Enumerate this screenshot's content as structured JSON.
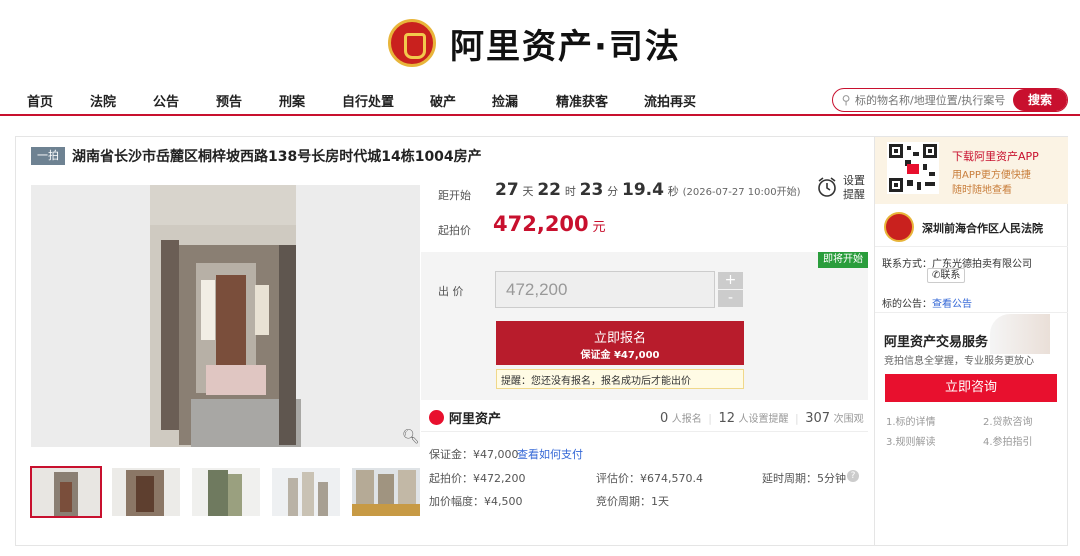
{
  "header": {
    "brand": "阿里资产·司法",
    "nav": [
      "首页",
      "法院",
      "公告",
      "预告",
      "刑案",
      "自行处置",
      "破产",
      "捡漏",
      "精准获客",
      "流拍再买"
    ],
    "search_placeholder": "标的物名称/地理位置/执行案号",
    "search_button": "搜索"
  },
  "item": {
    "badge": "一拍",
    "title": "湖南省长沙市岳麓区桐梓坡西路138号长房时代城14栋1004房产"
  },
  "countdown": {
    "label": "距开始",
    "days": "27",
    "days_unit": "天",
    "hours": "22",
    "hours_unit": "时",
    "minutes": "23",
    "minutes_unit": "分",
    "seconds": "19.4",
    "seconds_unit": "秒",
    "start_time": "(2026-07-27 10:00开始)",
    "remind_line1": "设置",
    "remind_line2": "提醒"
  },
  "price": {
    "label": "起拍价",
    "value": "472,200",
    "unit": "元"
  },
  "bid": {
    "label": "出 价",
    "input_value": "472,200",
    "plus": "+",
    "minus": "-",
    "soon_badge": "即将开始",
    "apply_line1": "立即报名",
    "apply_line2": "保证金 ¥47,000",
    "tip": "提醒：您还没有报名，报名成功后才能出价"
  },
  "stats": {
    "brand": "阿里资产",
    "signups": "0",
    "signups_label": "人报名",
    "reminders": "12",
    "reminders_label": "人设置提醒",
    "watchers": "307",
    "watchers_label": "次围观"
  },
  "details": {
    "deposit": "保证金：¥47,000",
    "deposit_link": "查看如何支付",
    "start_price": "起拍价：¥472,200",
    "appraisal": "评估价：¥674,570.4",
    "delay": "延时周期：5分钟",
    "increment": "加价幅度：¥4,500",
    "period": "竞价周期：1天"
  },
  "sidebar": {
    "app_title": "下载阿里资产APP",
    "app_line1": "用APP更方便快捷",
    "app_line2": "随时随地查看",
    "court": "深圳前海合作区人民法院",
    "contact_label": "联系方式：",
    "contact_value": "广东光德拍卖有限公司",
    "contact_button": "联系",
    "notice_label": "标的公告：",
    "notice_link": "查看公告",
    "service_title": "阿里资产交易服务",
    "service_sub": "竞拍信息全掌握，专业服务更放心",
    "consult_button": "立即咨询",
    "links": [
      "1.标的详情",
      "2.贷款咨询",
      "3.规则解读",
      "4.参拍指引"
    ]
  },
  "colors": {
    "accent": "#c8102e",
    "price": "#c8102e",
    "green": "#2a9d3c"
  }
}
